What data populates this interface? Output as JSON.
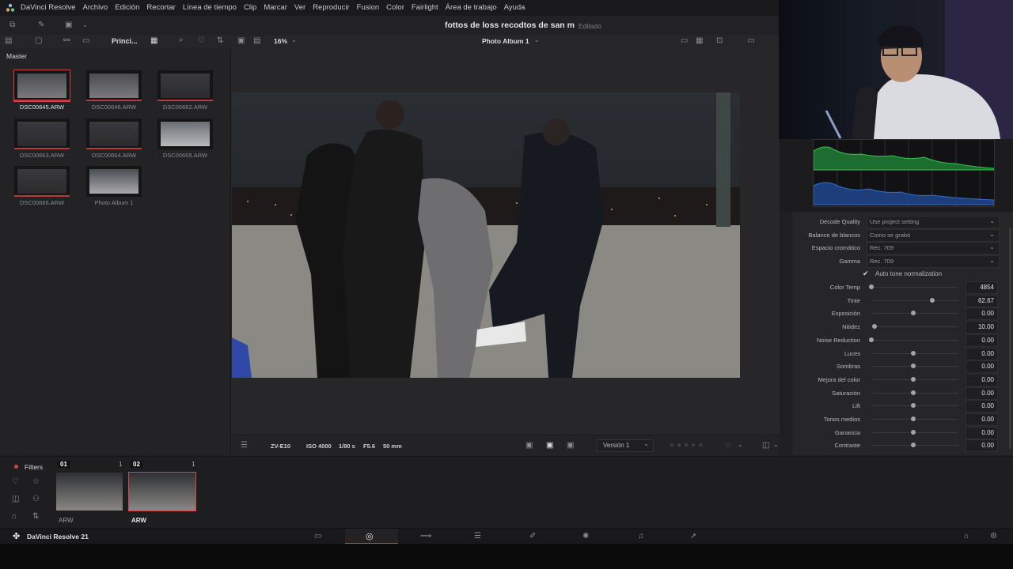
{
  "app": {
    "name": "DaVinci Resolve",
    "menu": [
      "DaVinci Resolve",
      "Archivo",
      "Edición",
      "Recortar",
      "Línea de tiempo",
      "Clip",
      "Marcar",
      "Ver",
      "Reproducir",
      "Fusion",
      "Color",
      "Fairlight",
      "Área de trabajo",
      "Ayuda"
    ]
  },
  "project": {
    "title": "fottos de loss recodtos de san m",
    "status": "Editado"
  },
  "toolbar": {
    "bin_tab": "Princi...",
    "zoom": "16%",
    "album": "Photo Album 1"
  },
  "media_pool": {
    "bin": "Master",
    "clips": [
      {
        "name": "DSC00645.ARW",
        "selected": true
      },
      {
        "name": "DSC00646.ARW",
        "selected": false
      },
      {
        "name": "DSC00662.ARW",
        "selected": false
      },
      {
        "name": "DSC00663.ARW",
        "selected": false
      },
      {
        "name": "DSC00664.ARW",
        "selected": false
      },
      {
        "name": "DSC00665.ARW",
        "selected": false
      },
      {
        "name": "DSC00666.ARW",
        "selected": false
      },
      {
        "name": "Photo Album 1",
        "selected": false
      }
    ]
  },
  "viewer_footer": {
    "camera": "ZV-E10",
    "iso": "ISO 4000",
    "shutter": "1/80 s",
    "aperture": "F5.6",
    "focal": "50 mm",
    "version": "Versión 1"
  },
  "inspector": {
    "dropdowns": [
      {
        "label": "Decode Quality",
        "value": "Use project setting"
      },
      {
        "label": "Balance de blancos",
        "value": "Como se grabó"
      },
      {
        "label": "Espacio cromático",
        "value": "Rec. 709"
      },
      {
        "label": "Gamma",
        "value": "Rec. 709"
      }
    ],
    "checkbox": {
      "label": "Auto tone normalization",
      "checked": true
    },
    "sliders": [
      {
        "label": "Color Temp",
        "value": "4854",
        "level": 0.0
      },
      {
        "label": "Tinte",
        "value": "62.67",
        "level": 0.7
      },
      {
        "label": "Exposición",
        "value": "0.00",
        "level": 0.48
      },
      {
        "label": "Nitidez",
        "value": "10.00",
        "level": 0.04
      },
      {
        "label": "Noise Reduction",
        "value": "0.00",
        "level": 0.0
      },
      {
        "label": "Luces",
        "value": "0.00",
        "level": 0.48
      },
      {
        "label": "Sombras",
        "value": "0.00",
        "level": 0.48
      },
      {
        "label": "Mejora del color",
        "value": "0.00",
        "level": 0.48
      },
      {
        "label": "Saturación",
        "value": "0.00",
        "level": 0.48
      },
      {
        "label": "Lift",
        "value": "0.00",
        "level": 0.48
      },
      {
        "label": "Tonos medios",
        "value": "0.00",
        "level": 0.48
      },
      {
        "label": "Ganancia",
        "value": "0.00",
        "level": 0.48
      },
      {
        "label": "Contraste",
        "value": "0.00",
        "level": 0.48
      }
    ]
  },
  "filmstrip": {
    "filters": "Filters",
    "items": [
      {
        "index": "01",
        "count": "1",
        "label": "ARW",
        "selected": false
      },
      {
        "index": "02",
        "count": "1",
        "label": "ARW",
        "selected": true
      }
    ]
  },
  "footer": {
    "brand": "DaVinci Resolve 21"
  },
  "colors": {
    "accent_red": "#d54545",
    "scope_green": "#33c24a",
    "scope_blue": "#2f6fd6"
  }
}
